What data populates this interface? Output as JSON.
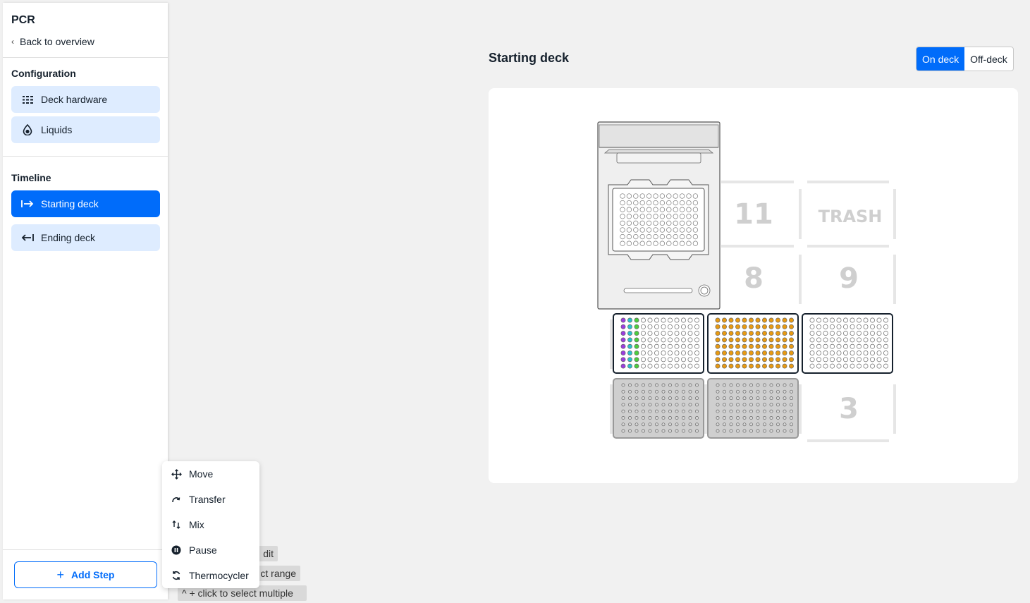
{
  "sidebar": {
    "project_title": "PCR",
    "back_label": "Back to overview",
    "configuration_heading": "Configuration",
    "config_items": [
      {
        "label": "Deck hardware",
        "icon": "grid-icon"
      },
      {
        "label": "Liquids",
        "icon": "droplet-icon"
      }
    ],
    "timeline_heading": "Timeline",
    "timeline_items": [
      {
        "label": "Starting deck",
        "icon": "arrow-right-bar-icon",
        "active": true
      },
      {
        "label": "Ending deck",
        "icon": "arrow-left-bar-icon",
        "active": false
      }
    ],
    "add_step_label": "Add Step"
  },
  "hints": [
    {
      "text": "dit"
    },
    {
      "text": "ct range"
    },
    {
      "text": "^ + click to select multiple"
    }
  ],
  "step_menu": {
    "items": [
      {
        "label": "Move",
        "icon": "move-icon"
      },
      {
        "label": "Transfer",
        "icon": "transfer-icon"
      },
      {
        "label": "Mix",
        "icon": "mix-icon"
      },
      {
        "label": "Pause",
        "icon": "pause-icon"
      },
      {
        "label": "Thermocycler",
        "icon": "thermocycler-icon"
      }
    ]
  },
  "main": {
    "title": "Starting deck",
    "toggle": {
      "on_deck": "On deck",
      "off_deck": "Off-deck",
      "selected": "On deck"
    }
  },
  "deck": {
    "slot_labels": {
      "slot_11": "11",
      "trash": "TRASH",
      "slot_8": "8",
      "slot_9": "9",
      "slot_3": "3"
    },
    "colors": {
      "accent": "#006cfa",
      "purple_liquid": "#9b3de0",
      "green_liquid": "#4ccd3e",
      "teal_liquid": "#2bc0c9",
      "orange_liquid": "#e89a12"
    }
  }
}
